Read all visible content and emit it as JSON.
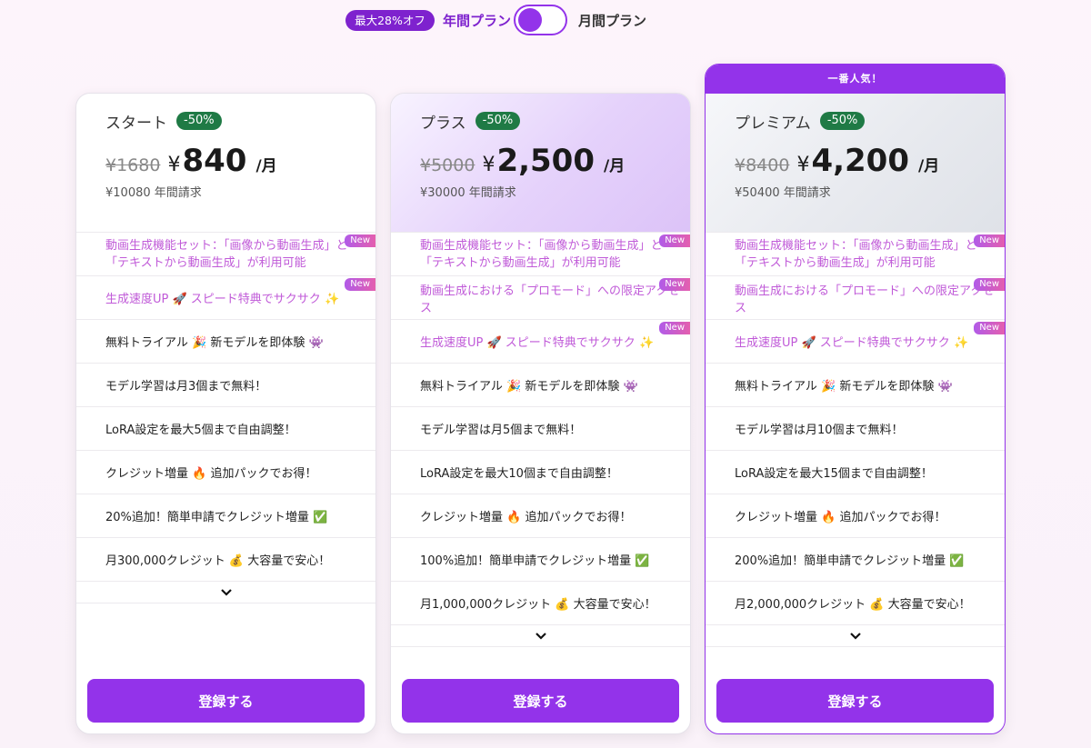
{
  "toggle": {
    "discount": "最大28%オフ",
    "annual": "年間プラン",
    "monthly": "月間プラン"
  },
  "new_label": "New",
  "expand_icon": "chevron-down-icon",
  "plans": [
    {
      "name": "スタート",
      "off": "-50%",
      "old_price": "¥1680",
      "currency": "¥",
      "price": "840",
      "per": "/月",
      "annual": "¥10080 年間請求",
      "features": [
        "動画生成機能セット：「画像から動画生成」と「テキストから動画生成」が利用可能",
        "生成速度UP 🚀 スピード特典でサクサク ✨",
        "無料トライアル 🎉 新モデルを即体験 👾",
        "モデル学習は月3個まで無料！",
        "LoRA設定を最大5個まで自由調整！",
        "クレジット増量 🔥 追加パックでお得！",
        "20%追加！簡単申請でクレジット増量 ✅",
        "月300,000クレジット 💰 大容量で安心！"
      ],
      "button": "登録する"
    },
    {
      "name": "プラス",
      "off": "-50%",
      "old_price": "¥5000",
      "currency": "¥",
      "price": "2,500",
      "per": "/月",
      "annual": "¥30000 年間請求",
      "features": [
        "動画生成機能セット：「画像から動画生成」と「テキストから動画生成」が利用可能",
        "動画生成における「プロモード」への限定アクセス",
        "生成速度UP 🚀 スピード特典でサクサク ✨",
        "無料トライアル 🎉 新モデルを即体験 👾",
        "モデル学習は月5個まで無料！",
        "LoRA設定を最大10個まで自由調整！",
        "クレジット増量 🔥 追加パックでお得！",
        "100%追加！簡単申請でクレジット増量 ✅",
        "月1,000,000クレジット 💰 大容量で安心！"
      ],
      "button": "登録する"
    },
    {
      "banner": "一番人気！",
      "name": "プレミアム",
      "off": "-50%",
      "old_price": "¥8400",
      "currency": "¥",
      "price": "4,200",
      "per": "/月",
      "annual": "¥50400 年間請求",
      "features": [
        "動画生成機能セット：「画像から動画生成」と「テキストから動画生成」が利用可能",
        "動画生成における「プロモード」への限定アクセス",
        "生成速度UP 🚀 スピード特典でサクサク ✨",
        "無料トライアル 🎉 新モデルを即体験 👾",
        "モデル学習は月10個まで無料！",
        "LoRA設定を最大15個まで自由調整！",
        "クレジット増量 🔥 追加パックでお得！",
        "200%追加！簡単申請でクレジット増量 ✅",
        "月2,000,000クレジット 💰 大容量で安心！"
      ],
      "button": "登録する"
    }
  ],
  "colors": {
    "accent": "#9333ea",
    "badge_green": "#1f7a45",
    "highlight_text": "#c05ad8"
  }
}
